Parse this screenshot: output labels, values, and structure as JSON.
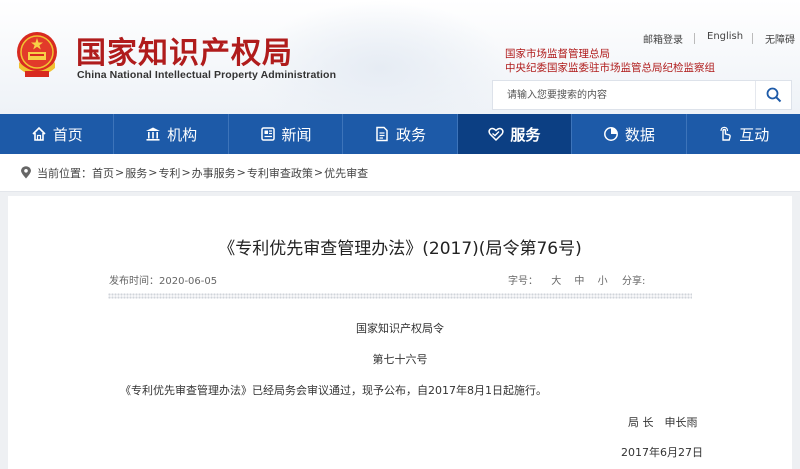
{
  "header": {
    "title_cn": "国家知识产权局",
    "title_en": "China National Intellectual Property Administration",
    "top_links": [
      "邮箱登录",
      "English",
      "无障碍"
    ],
    "gov_links": [
      "国家市场监督管理总局",
      "中央纪委国家监委驻市场监管总局纪检监察组"
    ],
    "search_placeholder": "请输入您要搜索的内容"
  },
  "nav": {
    "items": [
      {
        "label": "首页",
        "icon": "home-icon"
      },
      {
        "label": "机构",
        "icon": "institution-icon"
      },
      {
        "label": "新闻",
        "icon": "news-icon"
      },
      {
        "label": "政务",
        "icon": "government-icon"
      },
      {
        "label": "服务",
        "icon": "service-icon",
        "active": true
      },
      {
        "label": "数据",
        "icon": "data-chart-icon"
      },
      {
        "label": "互动",
        "icon": "interaction-icon"
      }
    ]
  },
  "breadcrumb": {
    "prefix": "当前位置：",
    "items": [
      "首页",
      "服务",
      "专利",
      "办事服务",
      "专利审查政策",
      "优先审查"
    ]
  },
  "article": {
    "title": "《专利优先审查管理办法》(2017)(局令第76号)",
    "publish_label": "发布时间：",
    "publish_date": "2020-06-05",
    "font_label": "字号：",
    "font_sizes": [
      "大",
      "中",
      "小"
    ],
    "share_label": "分享:",
    "paragraphs": [
      "国家知识产权局令",
      "第七十六号",
      "《专利优先审查管理办法》已经局务会审议通过，现予公布，自2017年8月1日起施行。",
      "局 长　申长雨",
      "2017年6月27日"
    ]
  },
  "colors": {
    "nav_bg": "#1d5aa8",
    "nav_active": "#0c3f83",
    "title_red": "#b01c1c"
  }
}
